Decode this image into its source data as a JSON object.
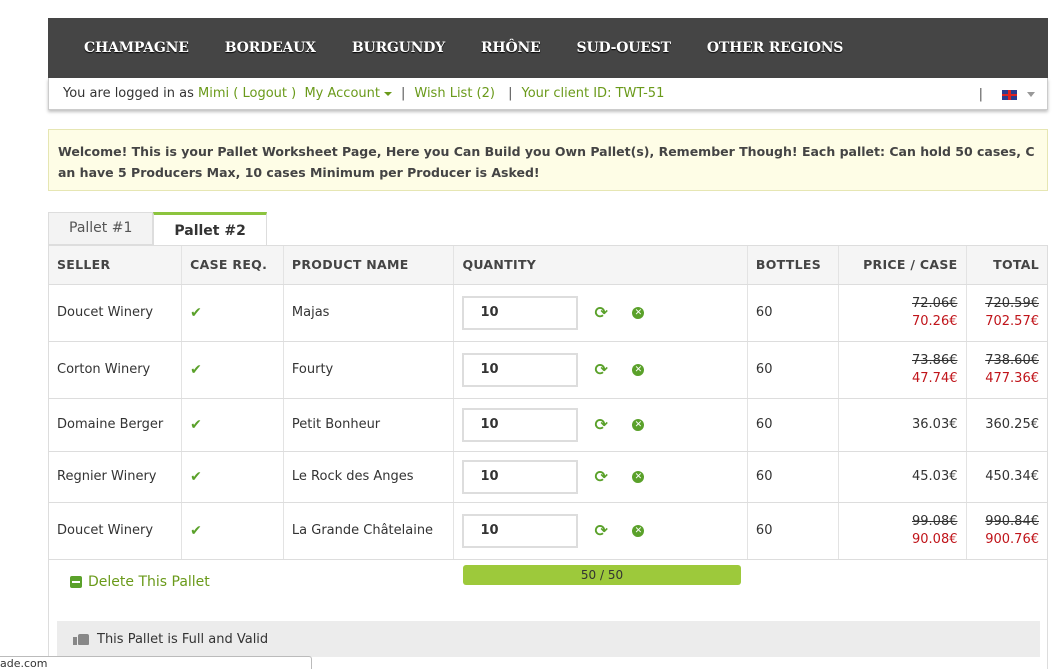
{
  "nav": [
    "CHAMPAGNE",
    "BORDEAUX",
    "BURGUNDY",
    "RHÔNE",
    "SUD-OUEST",
    "OTHER REGIONS"
  ],
  "userbar": {
    "logged_text": "You are logged in as",
    "user": "Mimi",
    "logout": "( Logout )",
    "account": "My Account",
    "wishlist": "Wish List (2)",
    "client_id": "Your client ID: TWT-51"
  },
  "notice": "Welcome! This is your Pallet Worksheet Page, Here you Can Build you Own Pallet(s), Remember Though! Each pallet: Can hold 50 cases, Can have 5 Producers Max, 10 cases Minimum per Producer is Asked!",
  "tabs": [
    "Pallet #1",
    "Pallet #2"
  ],
  "columns": [
    "SELLER",
    "CASE REQ.",
    "PRODUCT NAME",
    "QUANTITY",
    "BOTTLES",
    "PRICE / CASE",
    "TOTAL"
  ],
  "rows": [
    {
      "seller": "Doucet Winery",
      "product": "Majas",
      "qty": "10",
      "bottles": "60",
      "price_old": "72.06€",
      "price": "70.26€",
      "total_old": "720.59€",
      "total": "702.57€"
    },
    {
      "seller": "Corton Winery",
      "product": "Fourty",
      "qty": "10",
      "bottles": "60",
      "price_old": "73.86€",
      "price": "47.74€",
      "total_old": "738.60€",
      "total": "477.36€"
    },
    {
      "seller": "Domaine Berger",
      "product": "Petit Bonheur",
      "qty": "10",
      "bottles": "60",
      "price_old": "",
      "price": "36.03€",
      "total_old": "",
      "total": "360.25€"
    },
    {
      "seller": "Regnier Winery",
      "product": "Le Rock des Anges",
      "qty": "10",
      "bottles": "60",
      "price_old": "",
      "price": "45.03€",
      "total_old": "",
      "total": "450.34€"
    },
    {
      "seller": "Doucet Winery",
      "product": "La Grande Châtelaine",
      "qty": "10",
      "bottles": "60",
      "price_old": "99.08€",
      "price": "90.08€",
      "total_old": "990.84€",
      "total": "900.76€"
    }
  ],
  "delete_label": "Delete This Pallet",
  "progress": {
    "text": "50 / 50",
    "fraction": 1.0
  },
  "valid_text": "This Pallet is Full and Valid",
  "status_url": "ade.com"
}
